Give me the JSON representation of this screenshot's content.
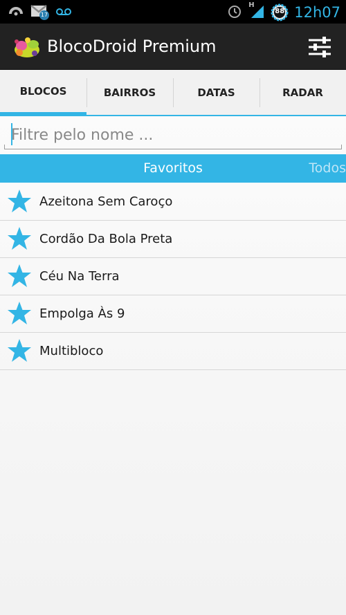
{
  "status_bar": {
    "time": "12h07",
    "battery_level": "88",
    "notification_count": "17",
    "network_type": "H"
  },
  "app": {
    "title": "BlocoDroid Premium"
  },
  "tabs": [
    {
      "label": "BLOCOS",
      "active": true
    },
    {
      "label": "BAIRROS",
      "active": false
    },
    {
      "label": "DATAS",
      "active": false
    },
    {
      "label": "RADAR",
      "active": false
    }
  ],
  "filter": {
    "placeholder": "Filtre pelo nome ...",
    "value": ""
  },
  "segment": {
    "current": "Favoritos",
    "next": "Todos"
  },
  "favorites": [
    {
      "name": "Azeitona Sem Caroço"
    },
    {
      "name": "Cordão Da Bola Preta"
    },
    {
      "name": "Céu Na Terra"
    },
    {
      "name": "Empolga Às 9"
    },
    {
      "name": "Multibloco"
    }
  ],
  "colors": {
    "accent": "#33b5e5",
    "actionbar": "#222222",
    "star": "#33b5e5"
  }
}
